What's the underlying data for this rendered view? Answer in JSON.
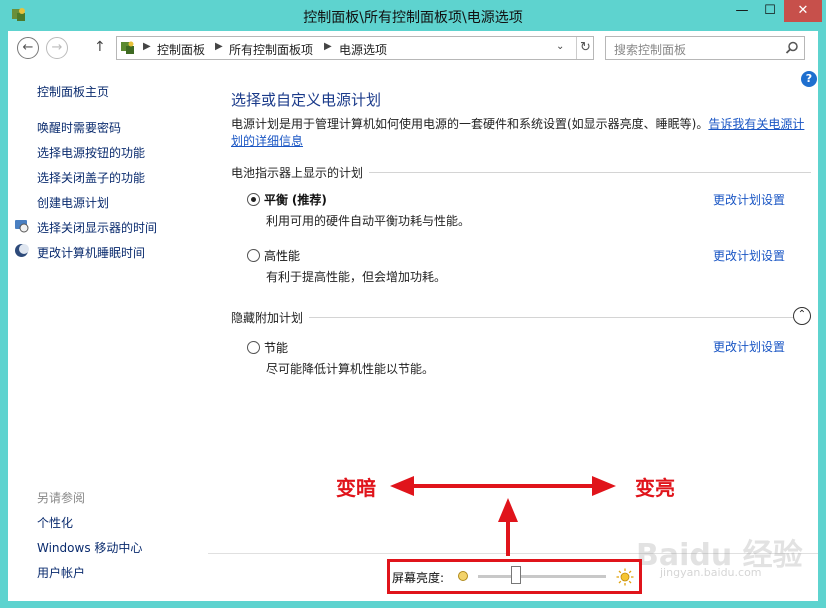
{
  "window": {
    "title": "控制面板\\所有控制面板项\\电源选项",
    "min_label": "—",
    "max_label": "☐",
    "close_label": "✕"
  },
  "nav": {
    "back_glyph": "←",
    "forward_glyph": "→",
    "up_glyph": "↑",
    "breadcrumbs": [
      "控制面板",
      "所有控制面板项",
      "电源选项"
    ],
    "separator": "▶",
    "dropdown_glyph": "⌄",
    "refresh_glyph": "↻",
    "search_placeholder": "搜索控制面板"
  },
  "help_label": "?",
  "sidebar": {
    "home": "控制面板主页",
    "items": [
      "唤醒时需要密码",
      "选择电源按钮的功能",
      "选择关闭盖子的功能",
      "创建电源计划",
      "选择关闭显示器的时间",
      "更改计算机睡眠时间"
    ],
    "see_also_heading": "另请参阅",
    "see_also": [
      "个性化",
      "Windows 移动中心",
      "用户帐户"
    ]
  },
  "main": {
    "heading": "选择或自定义电源计划",
    "description": "电源计划是用于管理计算机如何使用电源的一套硬件和系统设置(如显示器亮度、睡眠等)。",
    "description_link": "告诉我有关电源计划的详细信息",
    "section_battery": "电池指示器上显示的计划",
    "section_hidden": "隐藏附加计划",
    "collapse_glyph": "⌃",
    "plans": [
      {
        "name": "平衡",
        "tag": "(推荐)",
        "desc": "利用可用的硬件自动平衡功耗与性能。",
        "link": "更改计划设置",
        "selected": true
      },
      {
        "name": "高性能",
        "tag": "",
        "desc": "有利于提高性能，但会增加功耗。",
        "link": "更改计划设置",
        "selected": false
      },
      {
        "name": "节能",
        "tag": "",
        "desc": "尽可能降低计算机性能以节能。",
        "link": "更改计划设置",
        "selected": false
      }
    ]
  },
  "bottom": {
    "brightness_label": "屏幕亮度:",
    "brightness_level": 0.28
  },
  "annotations": {
    "dark_label": "变暗",
    "bright_label": "变亮",
    "color": "#e0141b"
  },
  "watermark": {
    "text": "Baidu 经验",
    "sub": "jingyan.baidu.com"
  }
}
